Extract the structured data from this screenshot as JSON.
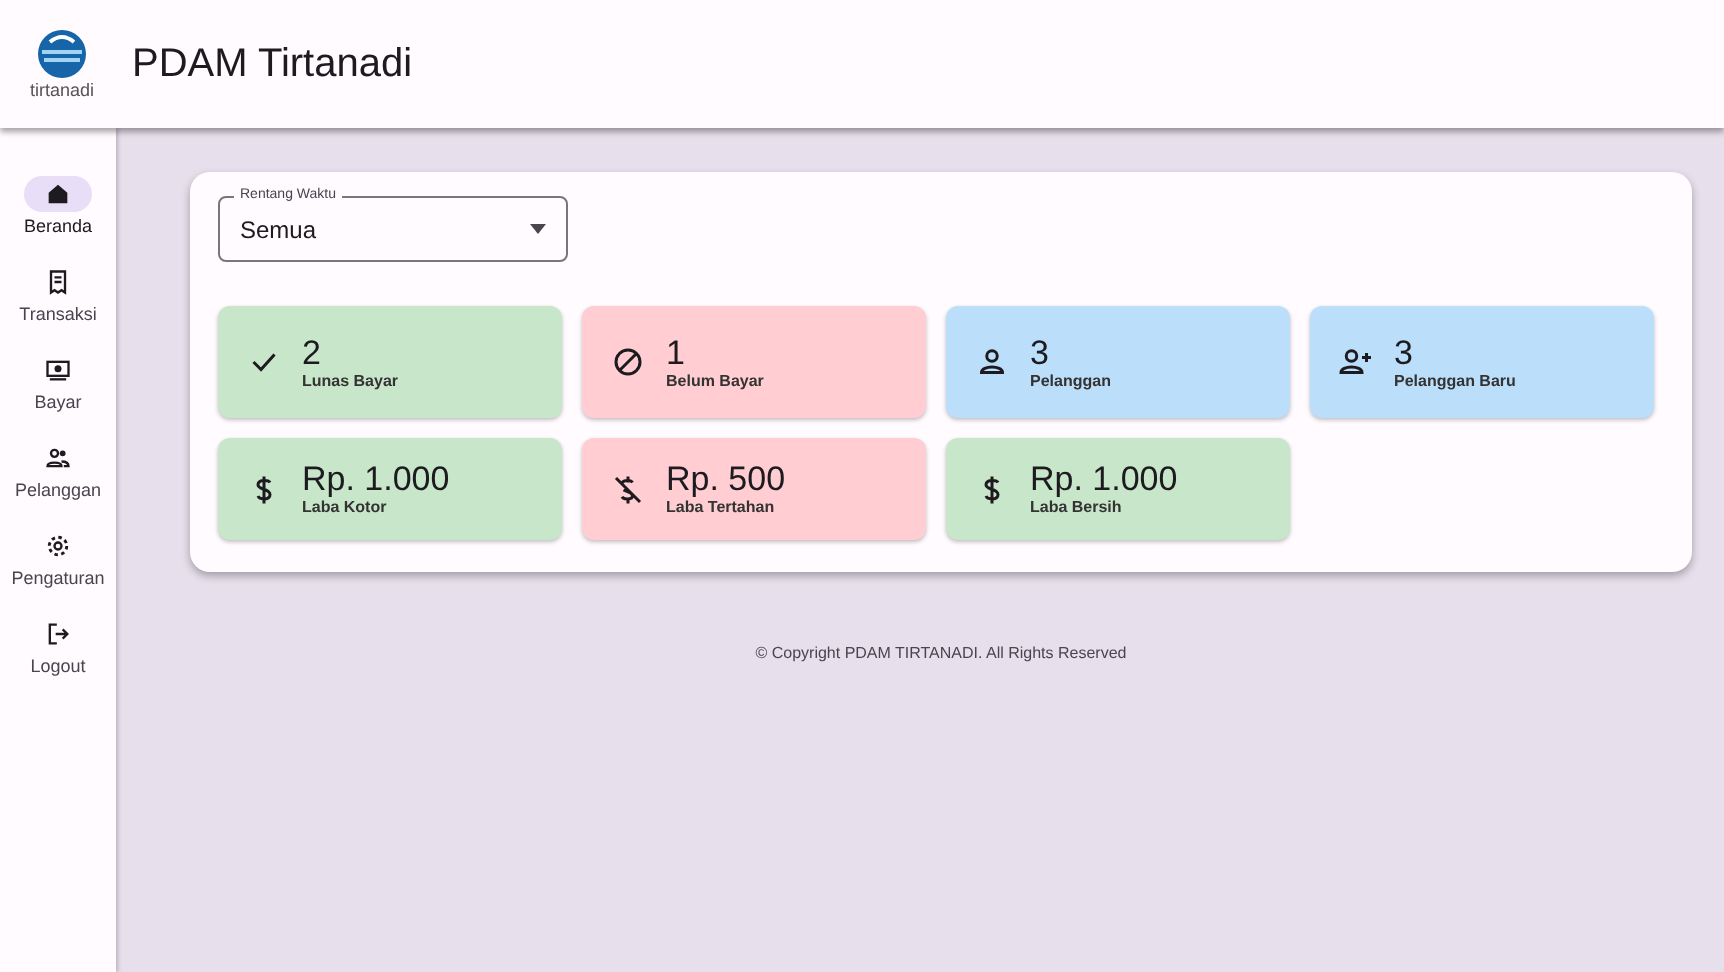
{
  "header": {
    "logo_caption": "tirtanadi",
    "title": "PDAM Tirtanadi"
  },
  "sidebar": {
    "items": [
      {
        "label": "Beranda",
        "kind": "home",
        "selected": true
      },
      {
        "label": "Transaksi",
        "kind": "receipt",
        "selected": false
      },
      {
        "label": "Bayar",
        "kind": "payment",
        "selected": false
      },
      {
        "label": "Pelanggan",
        "kind": "people",
        "selected": false
      },
      {
        "label": "Pengaturan",
        "kind": "gear",
        "selected": false
      },
      {
        "label": "Logout",
        "kind": "logout",
        "selected": false
      }
    ]
  },
  "filter": {
    "label": "Rentang Waktu",
    "value": "Semua"
  },
  "tiles": [
    {
      "value": "2",
      "label": "Lunas Bayar",
      "kind": "check",
      "color": "#c8e6c9"
    },
    {
      "value": "1",
      "label": "Belum Bayar",
      "kind": "blocked",
      "color": "#ffcdd2"
    },
    {
      "value": "3",
      "label": "Pelanggan",
      "kind": "person",
      "color": "#bbdefb"
    },
    {
      "value": "3",
      "label": "Pelanggan Baru",
      "kind": "personadd",
      "color": "#bbdefb"
    },
    {
      "value": "Rp. 1.000",
      "label": "Laba Kotor",
      "kind": "money",
      "color": "#c8e6c9"
    },
    {
      "value": "Rp. 500",
      "label": "Laba Tertahan",
      "kind": "moneyoff",
      "color": "#ffcdd2"
    },
    {
      "value": "Rp. 1.000",
      "label": "Laba Bersih",
      "kind": "money",
      "color": "#c8e6c9"
    }
  ],
  "footer": "© Copyright PDAM TIRTANADI. All Rights Reserved"
}
